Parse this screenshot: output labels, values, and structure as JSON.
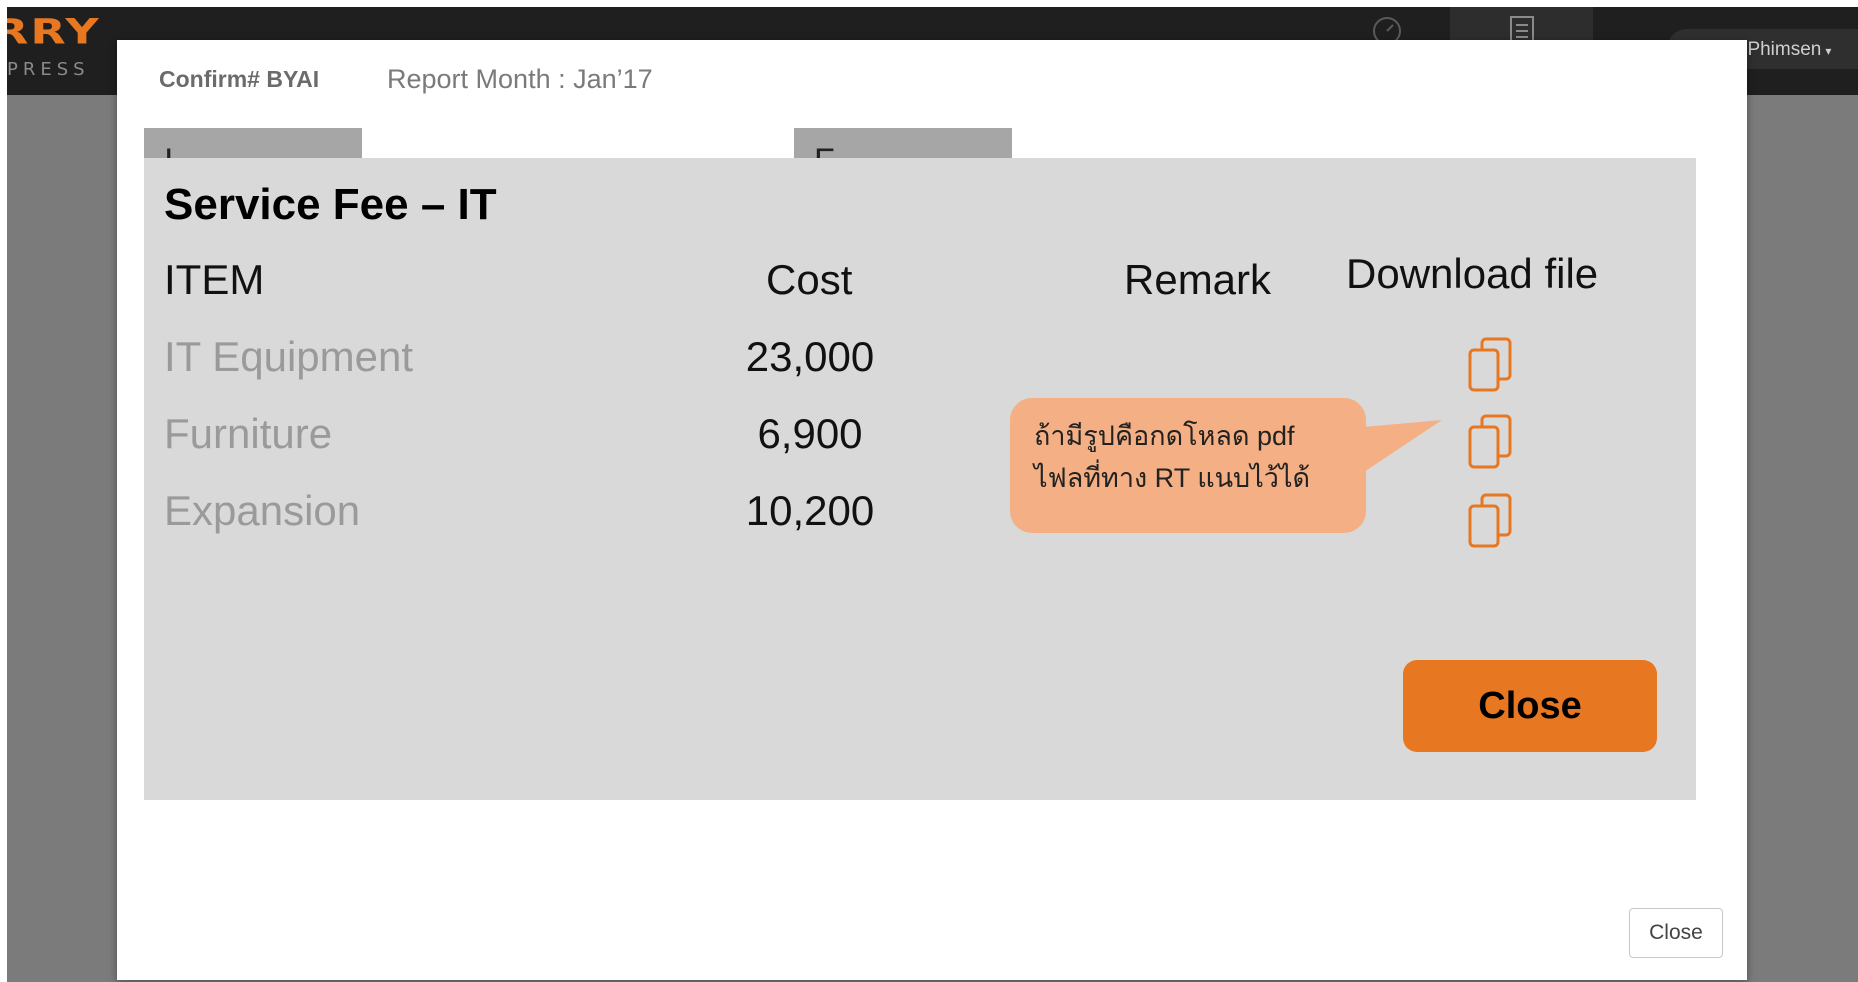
{
  "app": {
    "logo_text": "RRY",
    "logo_subtext": "PRESS",
    "user_name": "Bundid Phimsen"
  },
  "modal": {
    "confirm_label": "Confirm# BYAI",
    "report_month_label": "Report Month : Jan’17",
    "tab_stub_1": "I",
    "tab_stub_2": "F",
    "close_button_label": "Close"
  },
  "service_fee": {
    "title": "Service Fee – IT",
    "columns": {
      "item": "ITEM",
      "cost": "Cost",
      "remark": "Remark",
      "download": "Download file"
    },
    "rows": [
      {
        "item": "IT Equipment",
        "cost": "23,000",
        "remark": ""
      },
      {
        "item": "Furniture",
        "cost": "6,900",
        "remark": ""
      },
      {
        "item": "Expansion",
        "cost": "10,200",
        "remark": ""
      }
    ],
    "callout_line1": "ถ้ามีรูปคือกดโหลด pdf",
    "callout_line2": "ไฟลที่ทาง RT แนบไว้ได้",
    "close_label": "Close"
  },
  "colors": {
    "accent_orange": "#e87722",
    "callout_orange": "#f4b084",
    "panel_gray": "#d9d9d9",
    "topbar": "#1f1f1f"
  },
  "icons": {
    "download": "copy-document-icon",
    "dashboard": "speedometer-icon",
    "reports": "document-list-icon"
  }
}
